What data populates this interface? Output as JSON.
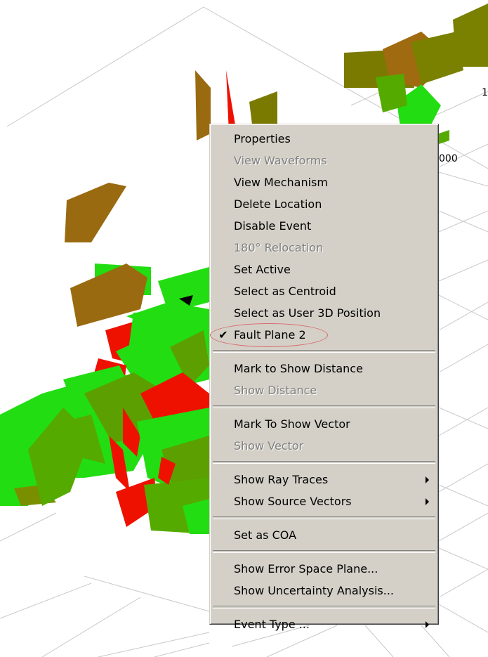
{
  "scene": {
    "axis_tick_labels": [
      "1",
      "000"
    ],
    "colors": {
      "green": "#22dd11",
      "red": "#ee1100",
      "olive": "#7a7a00",
      "brown": "#9a6a10",
      "grid": "#c8c8c8"
    }
  },
  "menu": {
    "items": [
      {
        "label": "Properties",
        "enabled": true
      },
      {
        "label": "View Waveforms",
        "enabled": false
      },
      {
        "label": "View Mechanism",
        "enabled": true
      },
      {
        "label": "Delete Location",
        "enabled": true
      },
      {
        "label": "Disable Event",
        "enabled": true
      },
      {
        "label": "180° Relocation",
        "enabled": false
      },
      {
        "label": "Set Active",
        "enabled": true
      },
      {
        "label": "Select as Centroid",
        "enabled": true
      },
      {
        "label": "Select as User 3D Position",
        "enabled": true
      },
      {
        "label": "Fault Plane 2",
        "enabled": true,
        "checked": true,
        "check_glyph": "✔"
      },
      {
        "label": "Mark to Show Distance",
        "enabled": true
      },
      {
        "label": "Show Distance",
        "enabled": false
      },
      {
        "label": "Mark To Show Vector",
        "enabled": true
      },
      {
        "label": "Show Vector",
        "enabled": false
      },
      {
        "label": "Show Ray Traces",
        "enabled": true,
        "submenu": true
      },
      {
        "label": "Show Source Vectors",
        "enabled": true,
        "submenu": true
      },
      {
        "label": "Set as COA",
        "enabled": true
      },
      {
        "label": "Show Error Space Plane...",
        "enabled": true
      },
      {
        "label": "Show Uncertainty Analysis...",
        "enabled": true
      },
      {
        "label": "Event Type ...",
        "enabled": true,
        "submenu": true
      }
    ],
    "highlight_color": "#d96b6b"
  }
}
